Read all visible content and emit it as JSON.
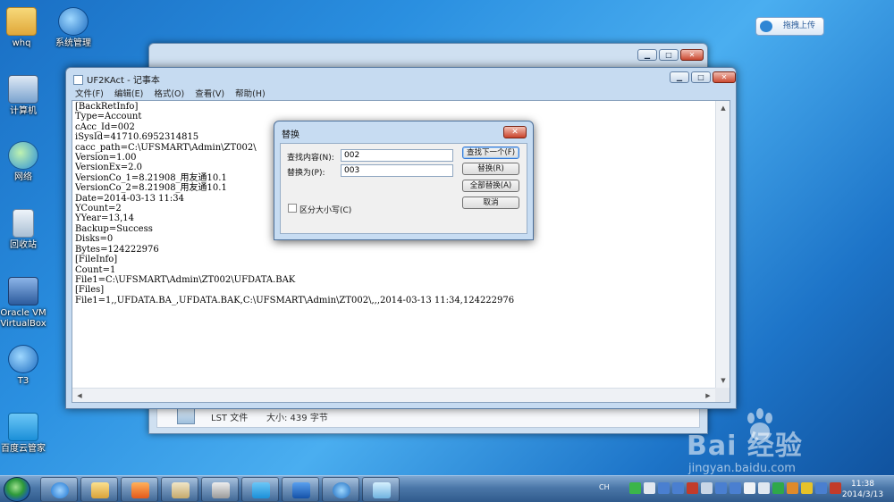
{
  "desktop": {
    "icons": [
      {
        "label": "whq",
        "icon": "folder-icon"
      },
      {
        "label": "系统管理",
        "icon": "system-manage-icon"
      },
      {
        "label": "计算机",
        "icon": "computer-icon"
      },
      {
        "label": "网络",
        "icon": "network-icon"
      },
      {
        "label": "回收站",
        "icon": "recycle-bin-icon"
      },
      {
        "label": "Oracle VM VirtualBox",
        "icon": "virtualbox-icon"
      },
      {
        "label": "T3",
        "icon": "t3-app-icon"
      },
      {
        "label": "百度云管家",
        "icon": "baidu-cloud-icon"
      }
    ],
    "upload_button": "拖拽上传"
  },
  "back_window": {
    "file_type": "LST 文件",
    "file_size": "大小: 439 字节"
  },
  "notepad": {
    "title": "UF2KAct - 记事本",
    "menu": [
      "文件(F)",
      "编辑(E)",
      "格式(O)",
      "查看(V)",
      "帮助(H)"
    ],
    "lines": [
      "[BackRetInfo]",
      "Type=Account",
      "cAcc_Id=002",
      "iSysId=41710.6952314815",
      "cacc_path=C:\\UFSMART\\Admin\\ZT002\\",
      "Version=1.00",
      "VersionEx=2.0",
      "VersionCo_1=8.21908_用友通10.1",
      "VersionCo_2=8.21908_用友通10.1",
      "Date=2014-03-13 11:34",
      "YCount=2",
      "YYear=13,14",
      "Backup=Success",
      "Disks=0",
      "Bytes=124222976",
      "[FileInfo]",
      "Count=1",
      "File1=C:\\UFSMART\\Admin\\ZT002\\UFDATA.BAK",
      "[Files]",
      "File1=1,,UFDATA.BA_,UFDATA.BAK,C:\\UFSMART\\Admin\\ZT002\\,,,2014-03-13 11:34,124222976"
    ]
  },
  "replace_dialog": {
    "title": "替换",
    "find_label": "查找内容(N):",
    "find_value": "002",
    "replace_label": "替换为(P):",
    "replace_value": "003",
    "find_next": "查找下一个(F)",
    "replace": "替换(R)",
    "replace_all": "全部替换(A)",
    "cancel": "取消",
    "match_case": "区分大小写(C)"
  },
  "watermark": {
    "brand": "Bai 经验",
    "url": "jingyan.baidu.com"
  },
  "taskbar": {
    "lang": "CH",
    "time": "11:38",
    "date": "2014/3/13",
    "apps": [
      "ie-icon",
      "explorer-icon",
      "media-player-icon",
      "paint-icon",
      "server-manager-icon",
      "baidu-cloud-icon",
      "maxthon-icon",
      "t3-app-icon",
      "notepad-icon"
    ]
  },
  "colors": {
    "accent": "#2a8fe0",
    "taskbar": "#3b6a9c"
  }
}
